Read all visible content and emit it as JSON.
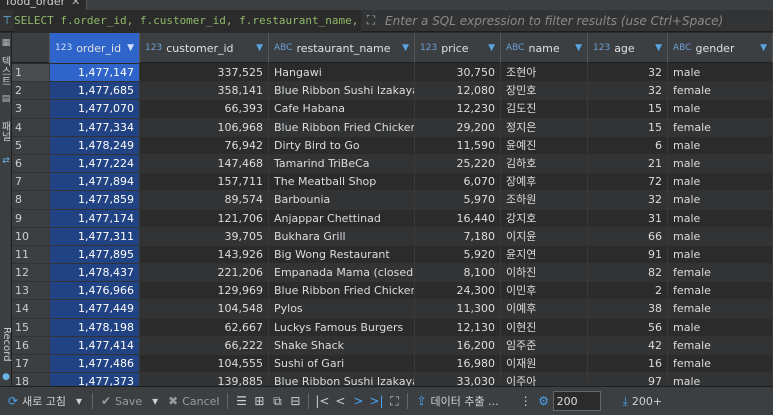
{
  "tab": {
    "title": "food_order",
    "close": "✕"
  },
  "filter": {
    "query": "SELECT f.order_id, f.customer_id, f.restaurant_name, f.price, c.name",
    "placeholder": "Enter a SQL expression to filter results (use Ctrl+Space)"
  },
  "left_strip": {
    "label1": "텍스트",
    "label2": "패널",
    "record": "Record"
  },
  "columns": [
    {
      "type": "123",
      "name": "order_id"
    },
    {
      "type": "123",
      "name": "customer_id"
    },
    {
      "type": "ABC",
      "name": "restaurant_name"
    },
    {
      "type": "123",
      "name": "price"
    },
    {
      "type": "ABC",
      "name": "name"
    },
    {
      "type": "123",
      "name": "age"
    },
    {
      "type": "ABC",
      "name": "gender"
    }
  ],
  "rows": [
    {
      "n": "1",
      "order_id": "1,477,147",
      "customer_id": "337,525",
      "restaurant_name": "Hangawi",
      "price": "30,750",
      "name": "조현아",
      "age": "32",
      "gender": "male"
    },
    {
      "n": "2",
      "order_id": "1,477,685",
      "customer_id": "358,141",
      "restaurant_name": "Blue Ribbon Sushi Izakaya",
      "price": "12,080",
      "name": "장민호",
      "age": "32",
      "gender": "female"
    },
    {
      "n": "3",
      "order_id": "1,477,070",
      "customer_id": "66,393",
      "restaurant_name": "Cafe Habana",
      "price": "12,230",
      "name": "김도진",
      "age": "15",
      "gender": "male"
    },
    {
      "n": "4",
      "order_id": "1,477,334",
      "customer_id": "106,968",
      "restaurant_name": "Blue Ribbon Fried Chicken",
      "price": "29,200",
      "name": "정지은",
      "age": "15",
      "gender": "female"
    },
    {
      "n": "5",
      "order_id": "1,478,249",
      "customer_id": "76,942",
      "restaurant_name": "Dirty Bird to Go",
      "price": "11,590",
      "name": "윤예진",
      "age": "6",
      "gender": "male"
    },
    {
      "n": "6",
      "order_id": "1,477,224",
      "customer_id": "147,468",
      "restaurant_name": "Tamarind TriBeCa",
      "price": "25,220",
      "name": "김하호",
      "age": "21",
      "gender": "male"
    },
    {
      "n": "7",
      "order_id": "1,477,894",
      "customer_id": "157,711",
      "restaurant_name": "The Meatball Shop",
      "price": "6,070",
      "name": "장예후",
      "age": "72",
      "gender": "male"
    },
    {
      "n": "8",
      "order_id": "1,477,859",
      "customer_id": "89,574",
      "restaurant_name": "Barbounia",
      "price": "5,970",
      "name": "조하원",
      "age": "32",
      "gender": "male"
    },
    {
      "n": "9",
      "order_id": "1,477,174",
      "customer_id": "121,706",
      "restaurant_name": "Anjappar Chettinad",
      "price": "16,440",
      "name": "강지호",
      "age": "31",
      "gender": "male"
    },
    {
      "n": "10",
      "order_id": "1,477,311",
      "customer_id": "39,705",
      "restaurant_name": "Bukhara Grill",
      "price": "7,180",
      "name": "이지윤",
      "age": "66",
      "gender": "male"
    },
    {
      "n": "11",
      "order_id": "1,477,895",
      "customer_id": "143,926",
      "restaurant_name": "Big Wong Restaurant",
      "price": "5,920",
      "name": "윤지연",
      "age": "91",
      "gender": "male"
    },
    {
      "n": "12",
      "order_id": "1,478,437",
      "customer_id": "221,206",
      "restaurant_name": "Empanada Mama (closed)",
      "price": "8,100",
      "name": "이하진",
      "age": "82",
      "gender": "female"
    },
    {
      "n": "13",
      "order_id": "1,476,966",
      "customer_id": "129,969",
      "restaurant_name": "Blue Ribbon Fried Chicken",
      "price": "24,300",
      "name": "이민후",
      "age": "2",
      "gender": "female"
    },
    {
      "n": "14",
      "order_id": "1,477,449",
      "customer_id": "104,548",
      "restaurant_name": "Pylos",
      "price": "11,300",
      "name": "이예후",
      "age": "38",
      "gender": "female"
    },
    {
      "n": "15",
      "order_id": "1,478,198",
      "customer_id": "62,667",
      "restaurant_name": "Luckys Famous Burgers",
      "price": "12,130",
      "name": "이현진",
      "age": "56",
      "gender": "male"
    },
    {
      "n": "16",
      "order_id": "1,477,414",
      "customer_id": "66,222",
      "restaurant_name": "Shake Shack",
      "price": "16,200",
      "name": "임주준",
      "age": "42",
      "gender": "female"
    },
    {
      "n": "17",
      "order_id": "1,477,486",
      "customer_id": "104,555",
      "restaurant_name": "Sushi of Gari",
      "price": "16,980",
      "name": "이재원",
      "age": "16",
      "gender": "female"
    },
    {
      "n": "18",
      "order_id": "1,477,373",
      "customer_id": "139,885",
      "restaurant_name": "Blue Ribbon Sushi Izakaya",
      "price": "33,030",
      "name": "이주아",
      "age": "97",
      "gender": "male"
    }
  ],
  "toolbar": {
    "refresh": "새로 고침",
    "save": "Save",
    "cancel": "Cancel",
    "export": "데이터 추출 ...",
    "fetch_size": "200",
    "fetch_more": "200+"
  },
  "colors": {
    "selected_column": "#214283",
    "selected_cell": "#2f65ca",
    "accent": "#4aa3f0"
  }
}
